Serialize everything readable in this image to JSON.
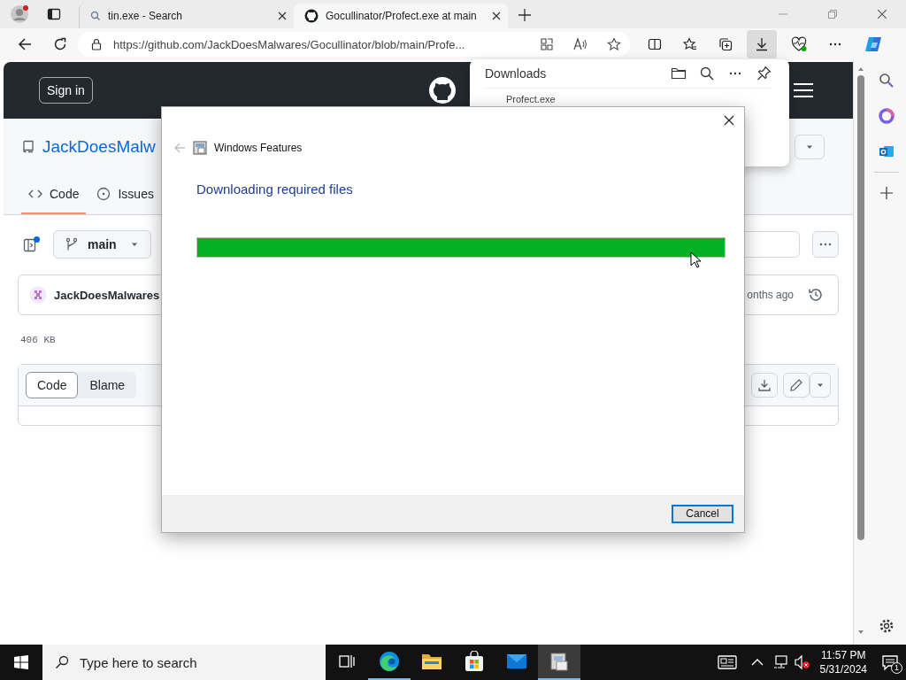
{
  "browser": {
    "tabs": [
      {
        "kind": "search",
        "title": "tin.exe - Search",
        "selected": false
      },
      {
        "kind": "github",
        "title": "Gocullinator/Profect.exe at main",
        "selected": true
      }
    ],
    "url": "https://github.com/JackDoesMalwares/Gocullinator/blob/main/Profe...",
    "downloads_button": {
      "selected": true
    }
  },
  "page": {
    "sign_in": "Sign in",
    "repo_owner": "JackDoesMalw",
    "tabs": [
      {
        "label": "Code",
        "selected": true
      },
      {
        "label": "Issues",
        "selected": false
      }
    ],
    "branch": "main",
    "commit_author": "JackDoesMalwares",
    "commit_time": "onths ago",
    "file_size": "406 KB",
    "view_tabs": [
      {
        "label": "Code",
        "selected": true
      },
      {
        "label": "Blame",
        "selected": false
      }
    ]
  },
  "downloads_panel": {
    "title": "Downloads",
    "items": [
      "Profect.exe"
    ]
  },
  "dialog": {
    "title": "Windows Features",
    "heading": "Downloading required files",
    "progress": {
      "level": 1
    },
    "buttons": [
      "Cancel"
    ]
  },
  "taskbar": {
    "search": {
      "placeholder": "Type here to search"
    },
    "apps": [
      {
        "kind": "task-view",
        "running": false,
        "selected": false
      },
      {
        "kind": "edge",
        "running": true,
        "selected": false
      },
      {
        "kind": "explorer",
        "running": false,
        "selected": false
      },
      {
        "kind": "store",
        "running": false,
        "selected": false
      },
      {
        "kind": "mail",
        "running": false,
        "selected": false
      },
      {
        "kind": "features",
        "running": true,
        "selected": true
      }
    ],
    "time": "11:57 PM",
    "date": "5/31/2024",
    "notifications": "1"
  }
}
